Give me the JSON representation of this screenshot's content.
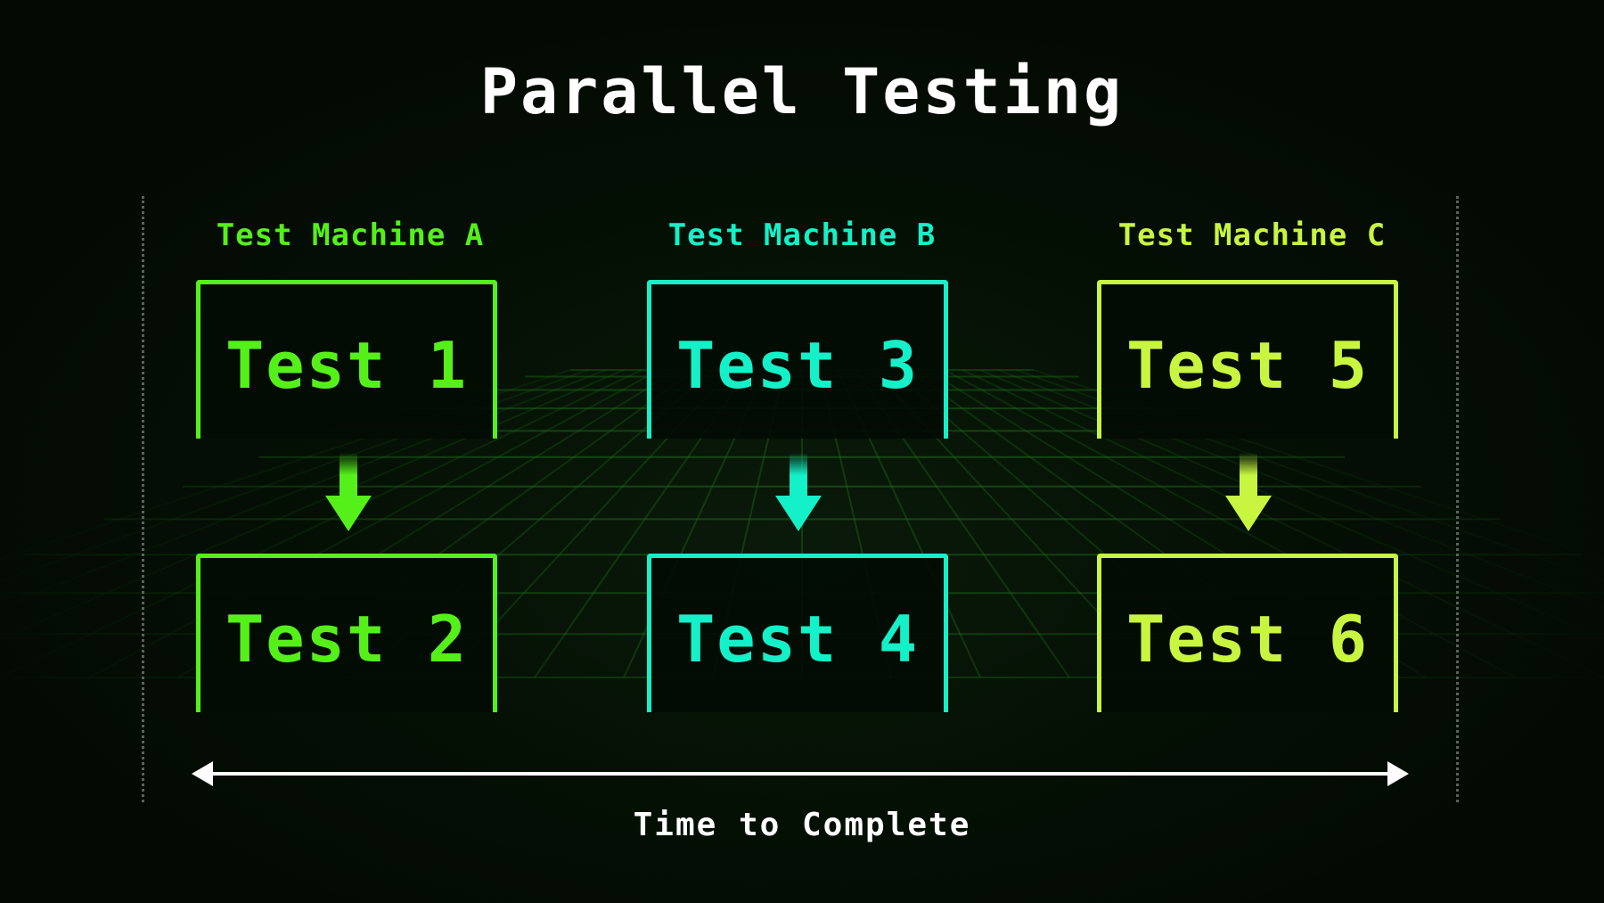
{
  "title": "Parallel Testing",
  "colors": {
    "machine_a": "#55f01a",
    "machine_b": "#14f0c8",
    "machine_c": "#c8f540",
    "grid": "#1f6a1a",
    "text": "#ffffff"
  },
  "machines": [
    {
      "label": "Test Machine A",
      "tests": [
        "Test 1",
        "Test 2"
      ]
    },
    {
      "label": "Test Machine B",
      "tests": [
        "Test 3",
        "Test 4"
      ]
    },
    {
      "label": "Test Machine C",
      "tests": [
        "Test 5",
        "Test 6"
      ]
    }
  ],
  "axis": {
    "label": "Time to Complete",
    "icon": "double-headed-arrow-icon"
  }
}
